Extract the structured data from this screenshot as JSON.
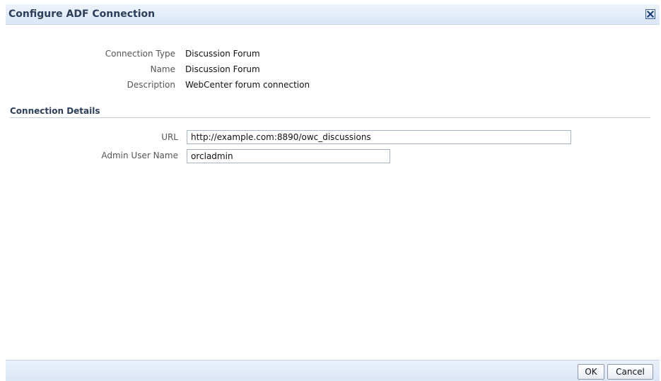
{
  "dialog": {
    "title": "Configure ADF Connection",
    "close_icon": "close-icon"
  },
  "info": {
    "connection_type_label": "Connection Type",
    "connection_type_value": "Discussion Forum",
    "name_label": "Name",
    "name_value": "Discussion Forum",
    "description_label": "Description",
    "description_value": "WebCenter forum connection"
  },
  "details": {
    "header": "Connection Details",
    "url_label": "URL",
    "url_value": "http://example.com:8890/owc_discussions",
    "admin_user_label": "Admin User Name",
    "admin_user_value": "orcladmin"
  },
  "footer": {
    "ok_label": "OK",
    "cancel_label": "Cancel"
  },
  "colors": {
    "title_text": "#2c3e5a",
    "titlebar_bg": "#dbe7f7",
    "footer_bg": "#dbe6f6"
  }
}
